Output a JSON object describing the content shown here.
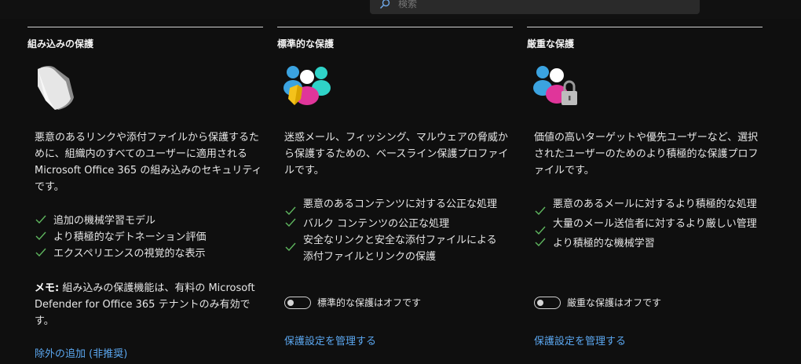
{
  "search": {
    "placeholder": "検索"
  },
  "columns": [
    {
      "title": "組み込みの保護",
      "hero_icon": "shield-icon",
      "description": "悪意のあるリンクや添付ファイルから保護するために、組織内のすべてのユーザーに適用される Microsoft Office 365 の組み込みのセキュリティです。",
      "features": [
        "追加の機械学習モデル",
        "より積極的なデトネーション評価",
        "エクスペリエンスの視覚的な表示"
      ],
      "memo_label": "メモ:",
      "memo_text": " 組み込みの保護機能は、有料の Microsoft Defender for Office 365 テナントのみ有効です。",
      "link": "除外の追加 (非推奨)"
    },
    {
      "title": "標準的な保護",
      "hero_icon": "user-group-shield-icon",
      "description": "迷惑メール、フィッシング、マルウェアの脅威から保護するための、ベースライン保護プロファイルです。",
      "features": [
        "悪意のあるコンテンツに対する公正な処理",
        "バルク コンテンツの公正な処理",
        "安全なリンクと安全な添付ファイルによる添付ファイルとリンクの保護"
      ],
      "toggle_label": "標準的な保護はオフです",
      "toggle_on": false,
      "link": "保護設定を管理する"
    },
    {
      "title": "厳重な保護",
      "hero_icon": "user-group-lock-icon",
      "description": "価値の高いターゲットや優先ユーザーなど、選択されたユーザーのためのより積極的な保護プロファイルです。",
      "features": [
        "悪意のあるメールに対するより積極的な処理",
        "大量のメール送信者に対するより厳しい管理",
        "より積極的な機械学習"
      ],
      "toggle_label": "厳重な保護はオフです",
      "toggle_on": false,
      "link": "保護設定を管理する"
    }
  ],
  "colors": {
    "accent_link": "#5ba7f0",
    "check": "#5fb65f",
    "background": "#0f0f0f"
  }
}
